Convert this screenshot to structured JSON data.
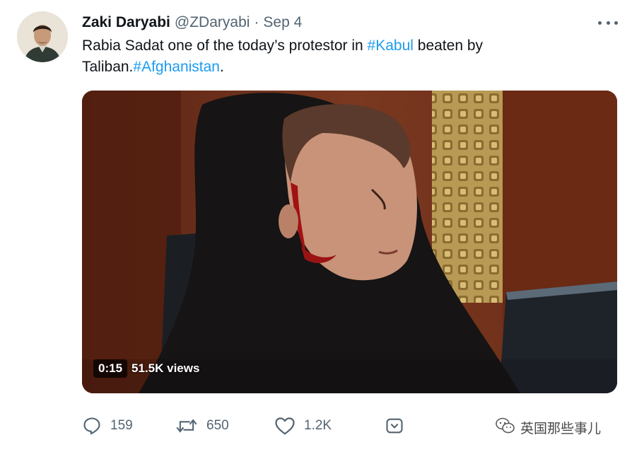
{
  "tweet": {
    "author_name": "Zaki Daryabi",
    "author_handle": "@ZDaryabi",
    "separator": "·",
    "date": "Sep 4",
    "text_segments": [
      {
        "text": "Rabia Sadat one of the today’s protestor in ",
        "type": "plain"
      },
      {
        "text": "#Kabul",
        "type": "hashtag"
      },
      {
        "text": " beaten by Taliban.",
        "type": "plain"
      },
      {
        "text": "#Afghanistan",
        "type": "hashtag"
      },
      {
        "text": ".",
        "type": "plain"
      }
    ],
    "media": {
      "duration": "0:15",
      "views": "51.5K views"
    },
    "actions": {
      "replies": "159",
      "retweets": "650",
      "likes": "1.2K"
    }
  },
  "watermark": {
    "text": "英国那些事儿",
    "icon": "wechat-icon"
  },
  "colors": {
    "hashtag": "#1d9bf0",
    "secondary": "#536471",
    "primary_text": "#0f1419"
  },
  "icons": {
    "reply": "speech-bubble-icon",
    "retweet": "retweet-arrows-icon",
    "like": "heart-icon",
    "share": "share-icon",
    "more": "three-dots-icon"
  }
}
